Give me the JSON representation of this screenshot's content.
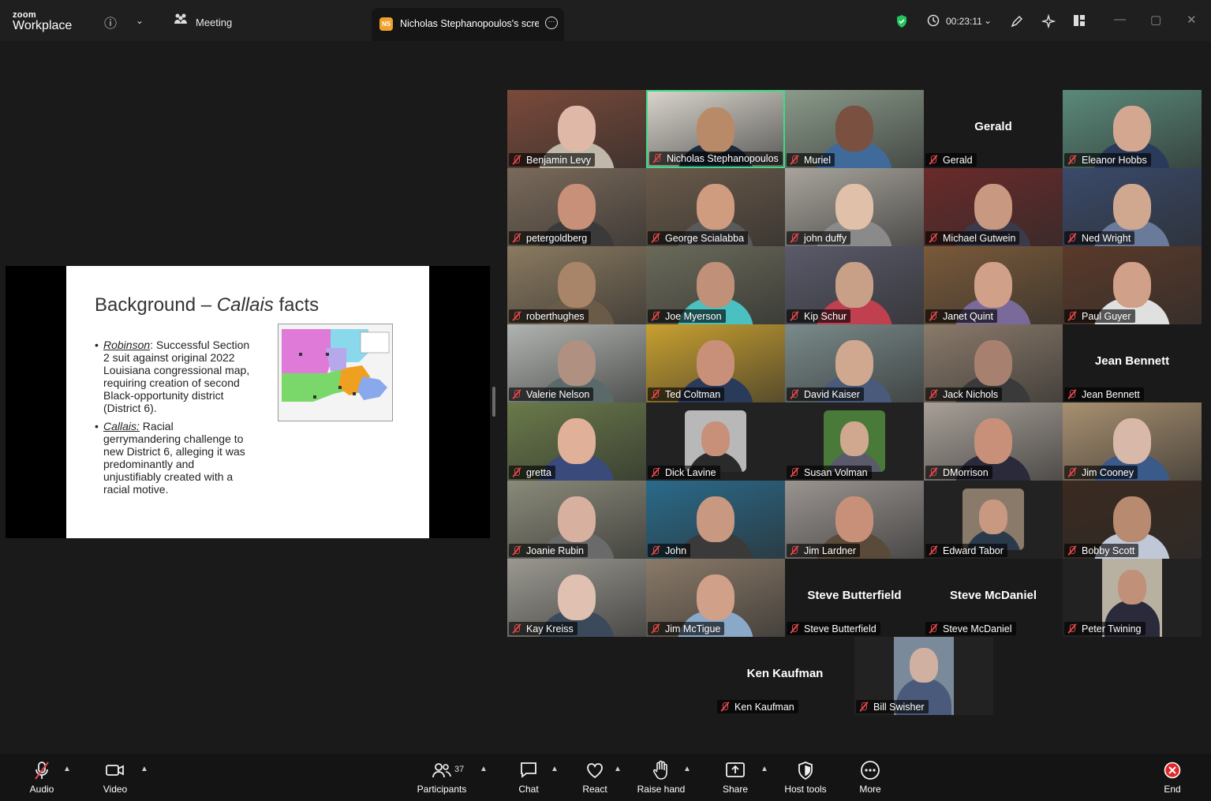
{
  "app": {
    "brand_line1": "zoom",
    "brand_line2": "Workplace",
    "meeting_label": "Meeting",
    "share_tab_label": "Nicholas Stephanopoulos's screen",
    "share_tab_initials": "NS",
    "timer": "00:23:11"
  },
  "slide": {
    "title_prefix": "Background – ",
    "title_italic": "Callais",
    "title_suffix": " facts",
    "bullet1_term": "Robinson",
    "bullet1_text": ": Successful Section 2 suit against original 2022 Louisiana congressional map, requiring creation of second Black-opportunity district (District 6).",
    "bullet2_term": "Callais:",
    "bullet2_text": " Racial gerrymandering challenge to new District 6, alleging it was predominantly and unjustifiably created with a racial motive."
  },
  "participants": [
    {
      "name": "Benjamin Levy",
      "bg": "#7a4a3a",
      "face": "#e0b8a8",
      "shirt": "#c0b8a8"
    },
    {
      "name": "Nicholas Stephanopoulos",
      "bg": "#d8d4cc",
      "face": "#b88a68",
      "shirt": "#1f2a3a",
      "active": true
    },
    {
      "name": "Muriel",
      "bg": "#8a9a8a",
      "face": "#7a5040",
      "shirt": "#3f6a9a"
    },
    {
      "name": "Gerald",
      "show_name": true
    },
    {
      "name": "Eleanor Hobbs",
      "bg": "#5a8a7a",
      "face": "#d4a890",
      "shirt": "#2a3a5a"
    },
    {
      "name": "petergoldberg",
      "bg": "#7a6a5a",
      "face": "#c89078",
      "shirt": "#3a3a3a"
    },
    {
      "name": "George Scialabba",
      "bg": "#6a5a4a",
      "face": "#d09c80",
      "shirt": "#5a5a5a"
    },
    {
      "name": "john duffy",
      "bg": "#a8a49c",
      "face": "#e0c0a8",
      "shirt": "#8a8a8a"
    },
    {
      "name": "Michael Gutwein",
      "bg": "#6a2a2a",
      "face": "#c89880",
      "shirt": "#3a3a4a"
    },
    {
      "name": "Ned Wright",
      "bg": "#3a4a6a",
      "face": "#d0a890",
      "shirt": "#6a7a9a"
    },
    {
      "name": "roberthughes",
      "bg": "#8a7a60",
      "face": "#a88468",
      "shirt": "#6a5a48"
    },
    {
      "name": "Joe Myerson",
      "bg": "#6a6a5a",
      "face": "#c09078",
      "shirt": "#4ac0c0"
    },
    {
      "name": "Kip Schur",
      "bg": "#5a5a6a",
      "face": "#c8a088",
      "shirt": "#c04050"
    },
    {
      "name": "Janet Quint",
      "bg": "#7a5a3a",
      "face": "#d0a088",
      "shirt": "#7a6a9a"
    },
    {
      "name": "Paul Guyer",
      "bg": "#5a3a2a",
      "face": "#d0a088",
      "shirt": "#e0e0e0"
    },
    {
      "name": "Valerie Nelson",
      "bg": "#b0b4b0",
      "face": "#b09080",
      "shirt": "#5a6a6a"
    },
    {
      "name": "Ted Coltman",
      "bg": "#c8a030",
      "face": "#c89078",
      "shirt": "#2a3a5a"
    },
    {
      "name": "David Kaiser",
      "bg": "#7a8a8a",
      "face": "#d0a890",
      "shirt": "#4a5a7a"
    },
    {
      "name": "Jack Nichols",
      "bg": "#8a7a6a",
      "face": "#a88070",
      "shirt": "#3a3a3a"
    },
    {
      "name": "Jean Bennett",
      "show_name": true
    },
    {
      "name": "gretta",
      "bg": "#6a7a4a",
      "face": "#e0b098",
      "shirt": "#3a4a7a"
    },
    {
      "name": "Dick Lavine",
      "thumb": true,
      "bg": "#b8b8b8",
      "face": "#c89078",
      "shirt": "#2a2a2a"
    },
    {
      "name": "Susan Volman",
      "thumb": true,
      "bg": "#4a7a3a",
      "face": "#d0a890",
      "shirt": "#5a5a6a"
    },
    {
      "name": "DMorrison",
      "bg": "#a8a098",
      "face": "#c89078",
      "shirt": "#2a2a3a"
    },
    {
      "name": "Jim Cooney",
      "bg": "#a89070",
      "face": "#d8b8a8",
      "shirt": "#3a5a8a"
    },
    {
      "name": "Joanie Rubin",
      "bg": "#8a8a7a",
      "face": "#d8b0a0",
      "shirt": "#6a6a6a"
    },
    {
      "name": "John",
      "bg": "#2a6a8a",
      "face": "#c89880",
      "shirt": "#3a3a3a"
    },
    {
      "name": "Jim Lardner",
      "bg": "#9a9490",
      "face": "#c89078",
      "shirt": "#5a4a3a"
    },
    {
      "name": "Edward Tabor",
      "thumb": true,
      "bg": "#8a7a6a",
      "face": "#c89880",
      "shirt": "#2a3a4a"
    },
    {
      "name": "Bobby Scott",
      "bg": "#3a2a20",
      "face": "#b88a70",
      "shirt": "#c0c8d8"
    },
    {
      "name": "Kay Kreiss",
      "bg": "#9a9890",
      "face": "#e0c0b0",
      "shirt": "#3a4a5a"
    },
    {
      "name": "Jim McTigue",
      "bg": "#8a7a68",
      "face": "#d0a088",
      "shirt": "#8aa8c8"
    },
    {
      "name": "Steve Butterfield",
      "show_name": true
    },
    {
      "name": "Steve McDaniel",
      "show_name": true
    },
    {
      "name": "Peter Twining",
      "narrow": true,
      "bg": "#b8b0a0",
      "face": "#c09078",
      "shirt": "#2a2a3a"
    },
    {
      "name": "Ken Kaufman",
      "show_name": true
    },
    {
      "name": "Bill Swisher",
      "narrow": true,
      "bg": "#7a8a9a",
      "face": "#d0b0a0",
      "shirt": "#4a5a7a"
    }
  ],
  "toolbar": {
    "audio": "Audio",
    "video": "Video",
    "participants": "Participants",
    "participant_count": "37",
    "chat": "Chat",
    "react": "React",
    "raise_hand": "Raise hand",
    "share": "Share",
    "host_tools": "Host tools",
    "more": "More",
    "end": "End"
  },
  "colors": {
    "active_speaker": "#3ddc84",
    "muted": "#e04848",
    "end": "#e02828",
    "shield": "#22c55e"
  }
}
